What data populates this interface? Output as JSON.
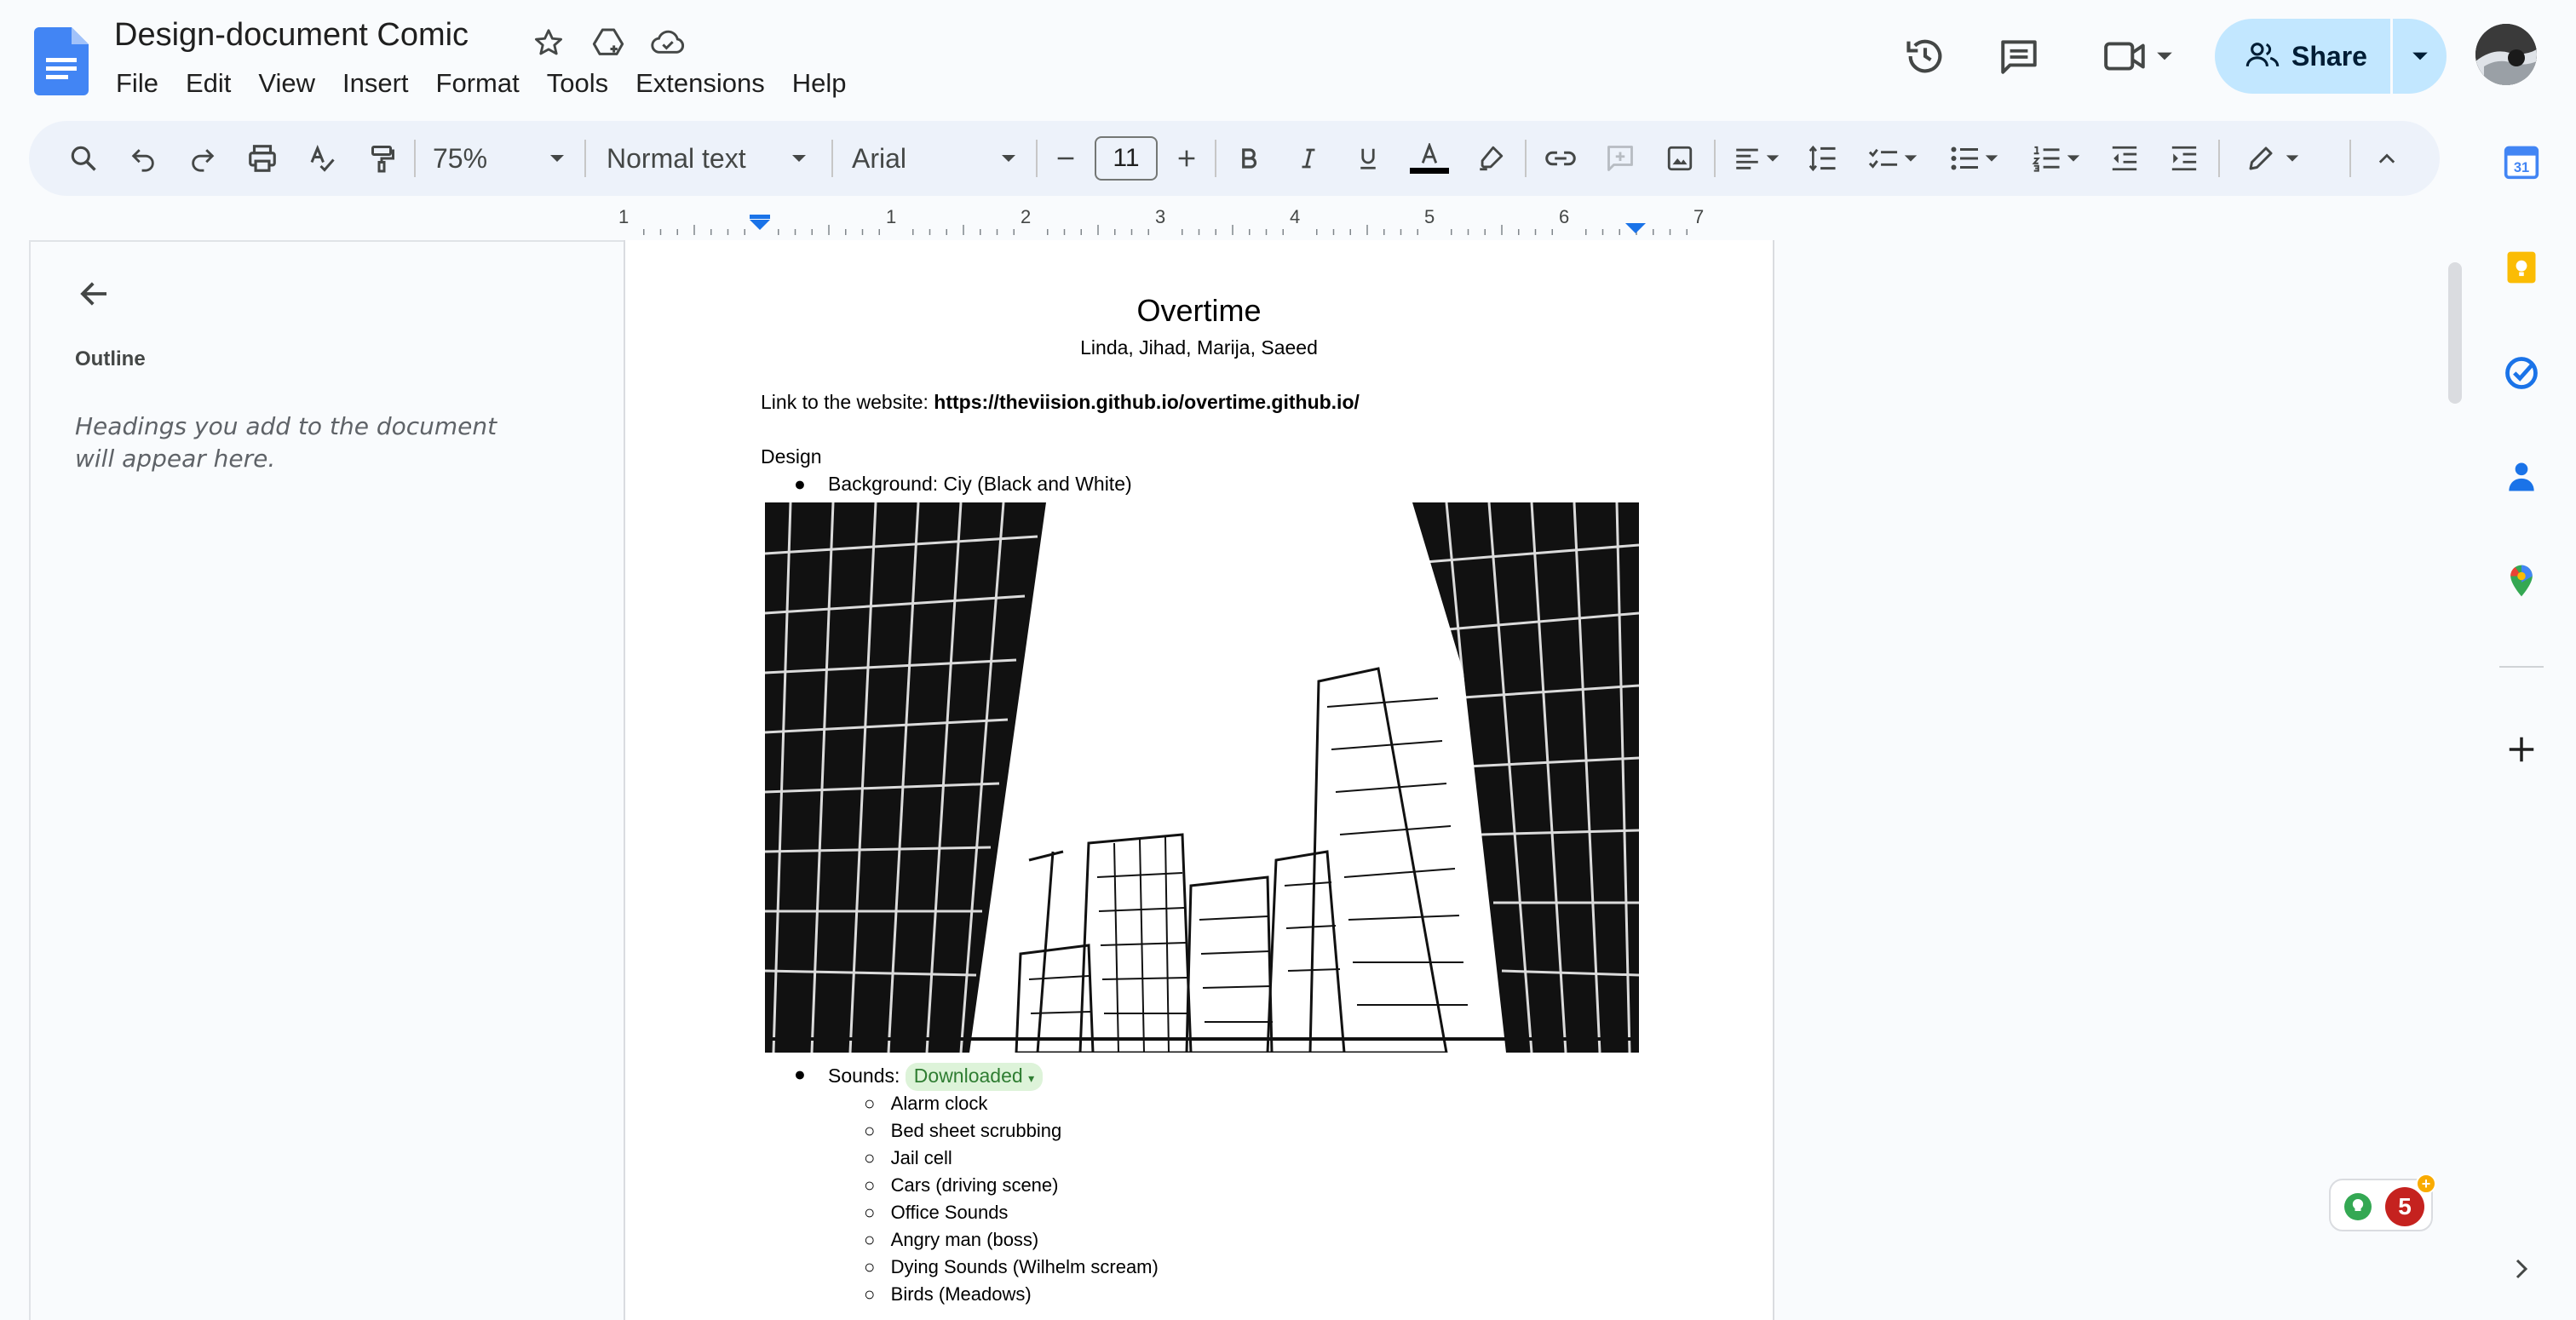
{
  "header": {
    "title": "Design-document Comic",
    "menu": [
      "File",
      "Edit",
      "View",
      "Insert",
      "Format",
      "Tools",
      "Extensions",
      "Help"
    ],
    "share_label": "Share"
  },
  "toolbar": {
    "zoom": "75%",
    "style": "Normal text",
    "font": "Arial",
    "font_size": "11"
  },
  "outline": {
    "title": "Outline",
    "hint": "Headings you add to the document will appear here."
  },
  "ruler": {
    "labels": [
      "1",
      "1",
      "2",
      "3",
      "4",
      "5",
      "6",
      "7"
    ]
  },
  "document": {
    "heading": "Overtime",
    "authors": "Linda, Jihad, Marija, Saeed",
    "link_prefix": "Link to the website: ",
    "link_url": "https://theviision.github.io/overtime.github.io/",
    "section": "Design",
    "background_item": "Background: Ciy (Black and White)",
    "sounds_label": "Sounds: ",
    "sounds_chip": "Downloaded",
    "sounds": [
      "Alarm clock",
      "Bed sheet scrubbing",
      "Jail cell",
      "Cars (driving scene)",
      "Office Sounds",
      "Angry man (boss)",
      "Dying Sounds (Wilhelm scream)",
      "Birds (Meadows)"
    ]
  },
  "badges": {
    "explore_count": "5"
  },
  "colors": {
    "accent": "#0b57d0",
    "share_bg": "#c2e7ff",
    "toolbar_bg": "#edf2fa",
    "chip_bg": "#ddf3d9",
    "chip_text": "#2f7d32",
    "badge_red": "#c5221f"
  },
  "icons": {
    "title_row": [
      "star-icon",
      "move-to-drive-icon",
      "cloud-saved-icon"
    ],
    "top_right": [
      "version-history-icon",
      "comments-icon",
      "meet-icon"
    ],
    "side_panel": [
      "calendar-icon",
      "keep-icon",
      "tasks-icon",
      "contacts-icon",
      "maps-icon",
      "add-icon"
    ]
  }
}
